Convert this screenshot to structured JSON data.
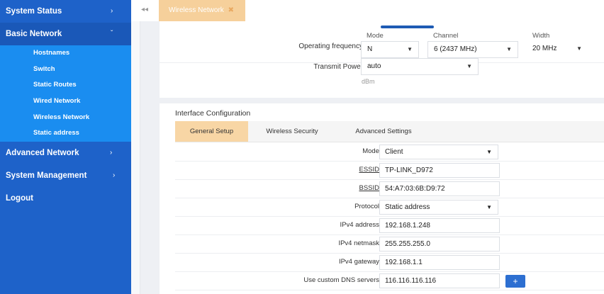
{
  "sidebar": {
    "system_status": "System Status",
    "basic_network": "Basic Network",
    "basic_items": [
      "Hostnames",
      "Switch",
      "Static Routes",
      "Wired Network",
      "Wireless Network",
      "Static address"
    ],
    "advanced_network": "Advanced Network",
    "system_management": "System Management",
    "logout": "Logout",
    "chevron": "›",
    "chevron_open": "ˇ"
  },
  "topbar": {
    "collapse_icon": "◂◂",
    "tab_label": "Wireless Network",
    "tab_close": "✖"
  },
  "panel1": {
    "freq_label": "Operating frequency",
    "mode_label": "Mode",
    "channel_label": "Channel",
    "width_label": "Width",
    "mode_value": "N",
    "channel_value": "6 (2437 MHz)",
    "width_value": "20 MHz",
    "tx_label": "Transmit Power",
    "tx_value": "auto",
    "tx_unit": "dBm"
  },
  "iface": {
    "title": "Interface Configuration",
    "tabs": [
      "General Setup",
      "Wireless Security",
      "Advanced Settings"
    ],
    "fields": {
      "mode_label": "Mode",
      "mode_value": "Client",
      "essid_label": "ESSID",
      "essid_value": "TP-LINK_D972",
      "bssid_label": "BSSID",
      "bssid_value": "54:A7:03:6B:D9:72",
      "protocol_label": "Protocol",
      "protocol_value": "Static address",
      "ipv4_addr_label": "IPv4 address",
      "ipv4_addr_value": "192.168.1.248",
      "netmask_label": "IPv4 netmask",
      "netmask_value": "255.255.255.0",
      "gateway_label": "IPv4 gateway",
      "gateway_value": "192.168.1.1",
      "dns_label": "Use custom DNS servers",
      "dns_value": "116.116.116.116",
      "add_label": "+"
    }
  },
  "caret": "▼"
}
